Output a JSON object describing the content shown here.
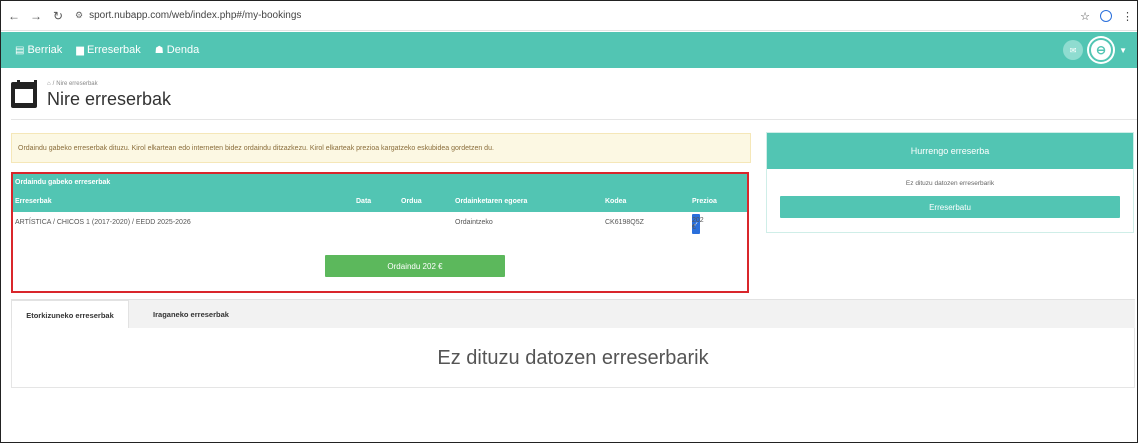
{
  "browser": {
    "url": "sport.nubapp.com/web/index.php#/my-bookings"
  },
  "nav": {
    "items": [
      {
        "label": "Berriak",
        "icon": "newspaper-icon"
      },
      {
        "label": "Erreserbak",
        "icon": "shopping-bag-icon"
      },
      {
        "label": "Denda",
        "icon": "shopping-basket-icon"
      }
    ]
  },
  "header": {
    "breadcrumb": "Nire erreserbak",
    "title": "Nire erreserbak"
  },
  "alert": {
    "text": "Ordaindu gabeko erreserbak dituzu. Kirol elkartean edo interneten bidez ordaindu ditzazkezu. Kirol elkarteak prezioa kargatzeko eskubidea gordetzen du."
  },
  "unpaid": {
    "title": "Ordaindu gabeko erreserbak",
    "columns": {
      "booking": "Erreserbak",
      "date": "Data",
      "time": "Ordua",
      "status": "Ordainketaren egoera",
      "code": "Kodea",
      "price": "Prezioa"
    },
    "rows": [
      {
        "booking": "ARTÍSTICA / CHICOS 1 (2017-2020) / EEDD 2025-2026",
        "date": "",
        "time": "",
        "status": "Ordaintzeko",
        "code": "CK6198Q5Z",
        "price": "202 €",
        "checked": true
      }
    ],
    "pay_button": "Ordaindu 202 €"
  },
  "next": {
    "title": "Hurrengo erreserba",
    "empty": "Ez dituzu datozen erreserbarik",
    "button": "Erreserbatu"
  },
  "tabs": {
    "items": [
      {
        "label": "Etorkizuneko erreserbak",
        "active": true
      },
      {
        "label": "Iraganeko erreserbak",
        "active": false
      }
    ],
    "empty_message": "Ez dituzu datozen erreserbarik"
  },
  "colors": {
    "primary": "#52c5b3",
    "success": "#5cb85c",
    "highlight": "#d9262b",
    "warning_bg": "#fcf8e3"
  }
}
